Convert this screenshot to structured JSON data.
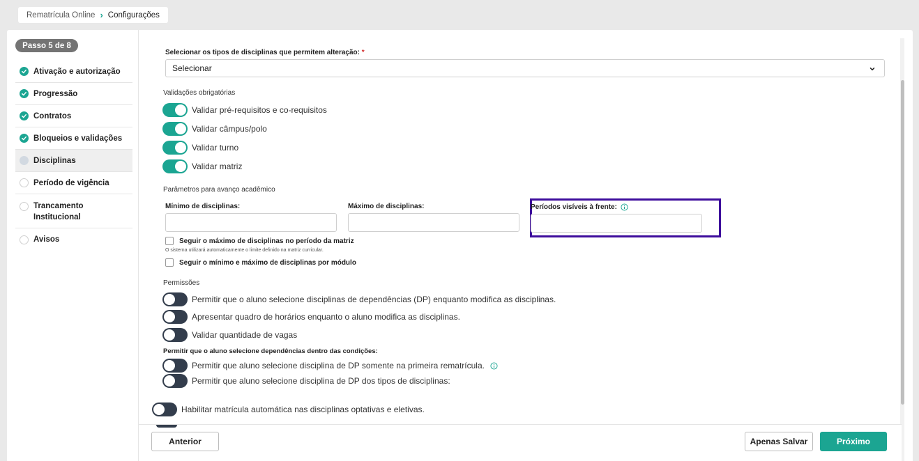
{
  "breadcrumb": {
    "root": "Rematrícula Online",
    "current": "Configurações"
  },
  "sidebar": {
    "step_badge": "Passo 5 de 8",
    "steps": [
      {
        "label": "Ativação e autorização",
        "status": "done"
      },
      {
        "label": "Progressão",
        "status": "done"
      },
      {
        "label": "Contratos",
        "status": "done"
      },
      {
        "label": "Bloqueios e validações",
        "status": "done"
      },
      {
        "label": "Disciplinas",
        "status": "current"
      },
      {
        "label": "Período de vigência",
        "status": "todo"
      },
      {
        "label": "Trancamento Institucional",
        "status": "todo"
      },
      {
        "label": "Avisos",
        "status": "todo"
      }
    ]
  },
  "form": {
    "tipos_label": "Selecionar os tipos de disciplinas que permitem alteração:",
    "required_mark": "*",
    "tipos_select_value": "Selecionar",
    "validacoes_title": "Validações obrigatórias",
    "validacoes": [
      {
        "label": "Validar pré-requisitos e co-requisitos",
        "on": true
      },
      {
        "label": "Validar câmpus/polo",
        "on": true
      },
      {
        "label": "Validar turno",
        "on": true
      },
      {
        "label": "Validar matriz",
        "on": true
      }
    ],
    "parametros_title": "Parâmetros para avanço acadêmico",
    "minimo_label": "Mínimo de disciplinas:",
    "minimo_value": "",
    "maximo_label": "Máximo de disciplinas:",
    "maximo_value": "",
    "periodos_label": "Períodos visíveis à frente:",
    "periodos_value": "",
    "check_maximo_periodo": "Seguir o máximo de disciplinas no período da matriz",
    "check_maximo_periodo_hint": "O sistema utilizará automaticamente o limite definido na matriz curricular.",
    "check_modulo": "Seguir o mínimo e máximo de disciplinas por módulo",
    "permissoes_title": "Permissões",
    "permissoes": [
      {
        "label": "Permitir que o aluno selecione disciplinas de dependências (DP) enquanto modifica as disciplinas.",
        "on": false
      },
      {
        "label": "Apresentar quadro de horários enquanto o aluno modifica as disciplinas.",
        "on": false
      },
      {
        "label": "Validar quantidade de vagas",
        "on": false
      }
    ],
    "dependencias_title": "Permitir que o aluno selecione dependências dentro das condições:",
    "dependencias": [
      {
        "label": "Permitir que aluno selecione disciplina de DP somente na primeira rematrícula.",
        "on": false
      },
      {
        "label": "Permitir que aluno selecione disciplina de DP dos tipos de disciplinas:",
        "on": false
      }
    ],
    "optativas": {
      "label": "Habilitar matrícula automática nas disciplinas optativas e eletivas.",
      "on": false
    }
  },
  "footer": {
    "anterior": "Anterior",
    "apenas_salvar": "Apenas Salvar",
    "proximo": "Próximo"
  },
  "colors": {
    "accent": "#1ba592",
    "toggle_off": "#333d4c",
    "highlight": "#3d0c9c",
    "required": "#d32f2f"
  }
}
